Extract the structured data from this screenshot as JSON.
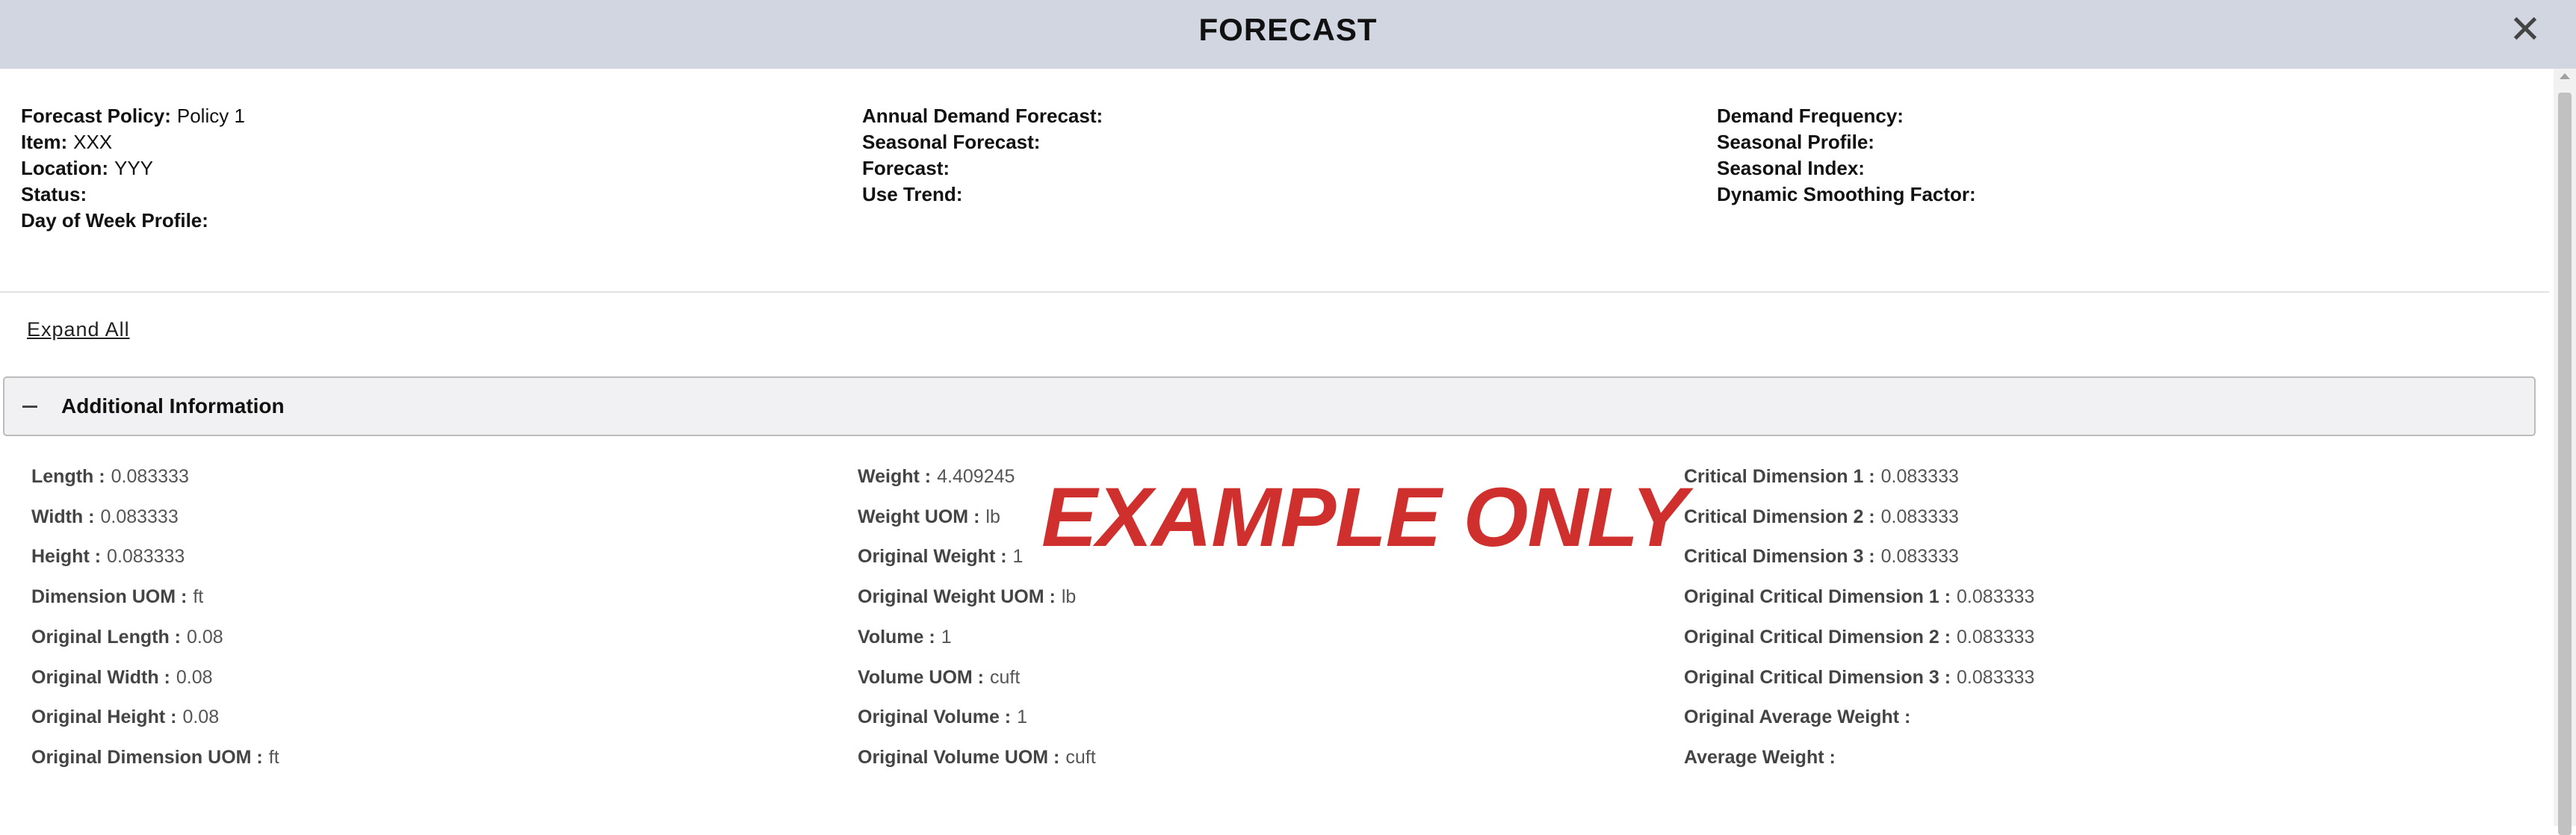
{
  "window": {
    "title": "FORECAST",
    "close_icon": "close-icon",
    "close_glyph": "✕"
  },
  "summary": {
    "col1": [
      {
        "label": "Forecast Policy:",
        "value": "Policy 1"
      },
      {
        "label": "Item:",
        "value": "XXX"
      },
      {
        "label": "Location:",
        "value": "YYY"
      },
      {
        "label": "Status:",
        "value": ""
      },
      {
        "label": "Day of Week Profile:",
        "value": ""
      }
    ],
    "col2": [
      {
        "label": "Annual Demand Forecast:",
        "value": ""
      },
      {
        "label": "Seasonal Forecast:",
        "value": ""
      },
      {
        "label": "Forecast:",
        "value": ""
      },
      {
        "label": "Use Trend:",
        "value": ""
      }
    ],
    "col3": [
      {
        "label": "Demand Frequency:",
        "value": ""
      },
      {
        "label": "Seasonal Profile:",
        "value": ""
      },
      {
        "label": "Seasonal Index:",
        "value": ""
      },
      {
        "label": "Dynamic Smoothing Factor:",
        "value": ""
      }
    ]
  },
  "expand_all": "Expand All",
  "section": {
    "title": "Additional Information",
    "toggle_icon": "collapse-icon",
    "col1": [
      {
        "label": "Length :",
        "value": "0.083333"
      },
      {
        "label": "Width :",
        "value": "0.083333"
      },
      {
        "label": "Height :",
        "value": "0.083333"
      },
      {
        "label": "Dimension UOM :",
        "value": "ft"
      },
      {
        "label": "Original Length :",
        "value": "0.08"
      },
      {
        "label": "Original Width :",
        "value": "0.08"
      },
      {
        "label": "Original Height :",
        "value": "0.08"
      },
      {
        "label": "Original Dimension UOM :",
        "value": "ft"
      }
    ],
    "col2": [
      {
        "label": "Weight :",
        "value": "4.409245"
      },
      {
        "label": "Weight UOM :",
        "value": "lb"
      },
      {
        "label": "Original Weight :",
        "value": "1"
      },
      {
        "label": "Original Weight UOM :",
        "value": "lb"
      },
      {
        "label": "Volume :",
        "value": "1"
      },
      {
        "label": "Volume UOM :",
        "value": "cuft"
      },
      {
        "label": "Original Volume :",
        "value": "1"
      },
      {
        "label": "Original Volume UOM :",
        "value": "cuft"
      }
    ],
    "col3": [
      {
        "label": "Critical Dimension 1 :",
        "value": "0.083333"
      },
      {
        "label": "Critical Dimension 2 :",
        "value": "0.083333"
      },
      {
        "label": "Critical Dimension 3 :",
        "value": "0.083333"
      },
      {
        "label": "Original Critical Dimension 1 :",
        "value": "0.083333"
      },
      {
        "label": "Original Critical Dimension 2 :",
        "value": "0.083333"
      },
      {
        "label": "Original Critical Dimension 3 :",
        "value": "0.083333"
      },
      {
        "label": "Original Average Weight :",
        "value": ""
      },
      {
        "label": "Average Weight :",
        "value": ""
      }
    ]
  },
  "watermark": "EXAMPLE ONLY",
  "colors": {
    "titlebar": "#d2d6e0",
    "watermark": "#d0302d",
    "section_header_bg": "#f1f1f3"
  }
}
